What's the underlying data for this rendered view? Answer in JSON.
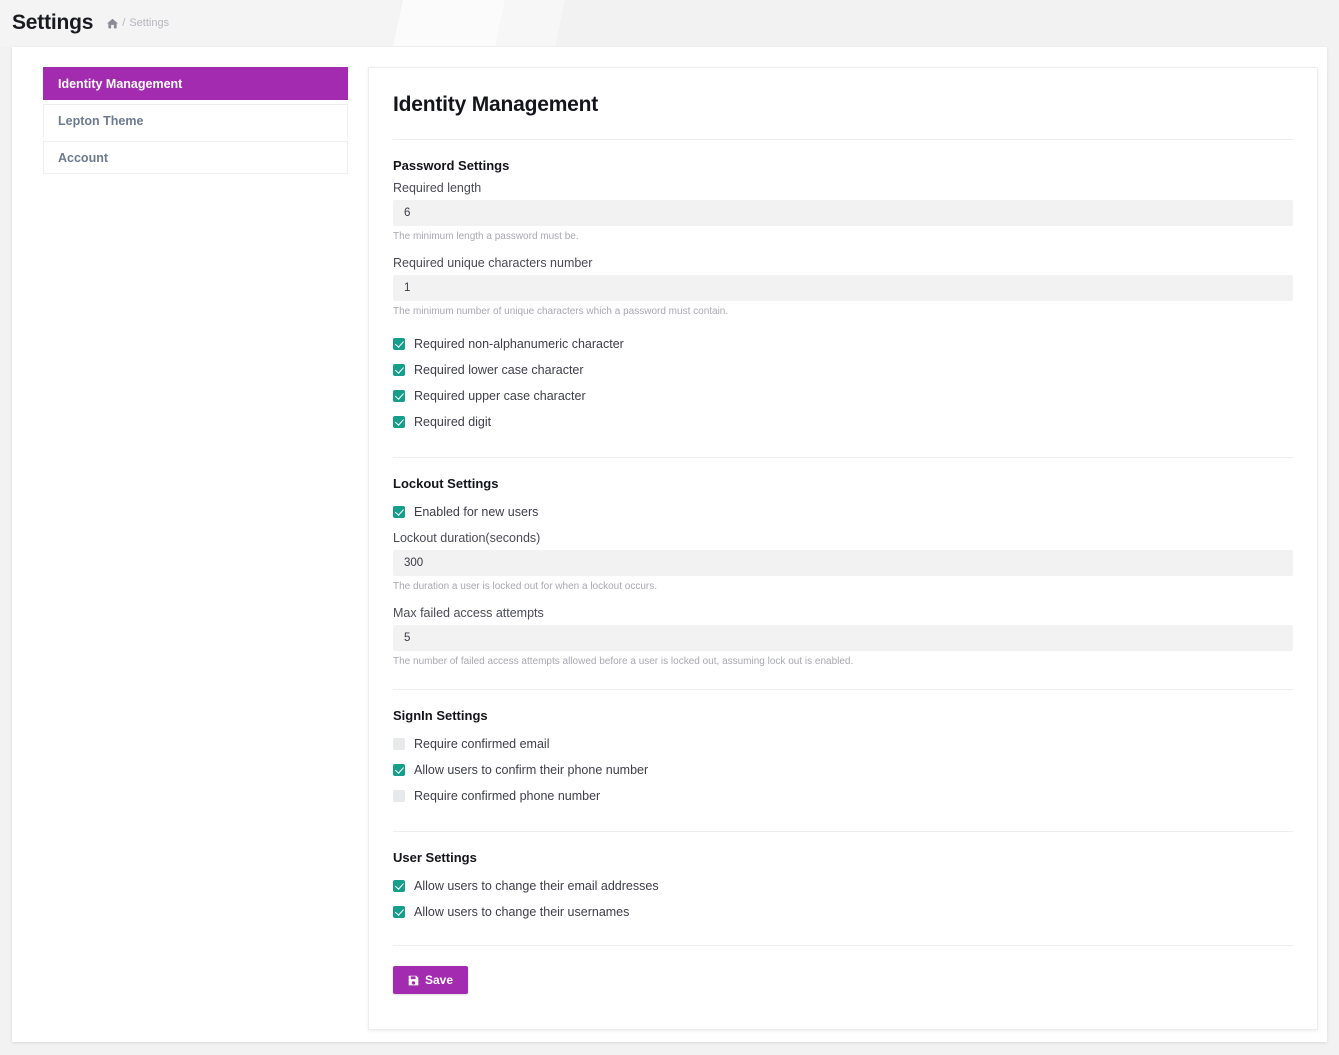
{
  "header": {
    "title": "Settings",
    "breadcrumb": {
      "home_icon": "home-icon",
      "separator": "/",
      "current": "Settings"
    }
  },
  "sidebar": {
    "items": [
      {
        "label": "Identity Management",
        "active": true
      },
      {
        "label": "Lepton Theme",
        "active": false
      },
      {
        "label": "Account",
        "active": false
      }
    ]
  },
  "main": {
    "title": "Identity Management",
    "sections": [
      {
        "id": "password-settings",
        "title": "Password Settings",
        "fields": [
          {
            "label": "Required length",
            "value": "6",
            "hint": "The minimum length a password must be."
          },
          {
            "label": "Required unique characters number",
            "value": "1",
            "hint": "The minimum number of unique characters which a password must contain."
          }
        ],
        "checkboxes": [
          {
            "label": "Required non-alphanumeric character",
            "checked": true
          },
          {
            "label": "Required lower case character",
            "checked": true
          },
          {
            "label": "Required upper case character",
            "checked": true
          },
          {
            "label": "Required digit",
            "checked": true
          }
        ]
      },
      {
        "id": "lockout-settings",
        "title": "Lockout Settings",
        "checkboxes_top": [
          {
            "label": "Enabled for new users",
            "checked": true
          }
        ],
        "fields": [
          {
            "label": "Lockout duration(seconds)",
            "value": "300",
            "hint": "The duration a user is locked out for when a lockout occurs."
          },
          {
            "label": "Max failed access attempts",
            "value": "5",
            "hint": "The number of failed access attempts allowed before a user is locked out, assuming lock out is enabled."
          }
        ]
      },
      {
        "id": "signin-settings",
        "title": "SignIn Settings",
        "checkboxes": [
          {
            "label": "Require confirmed email",
            "checked": false
          },
          {
            "label": "Allow users to confirm their phone number",
            "checked": true
          },
          {
            "label": "Require confirmed phone number",
            "checked": false
          }
        ]
      },
      {
        "id": "user-settings",
        "title": "User Settings",
        "checkboxes": [
          {
            "label": "Allow users to change their email addresses",
            "checked": true
          },
          {
            "label": "Allow users to change their usernames",
            "checked": true
          }
        ]
      }
    ],
    "save_button": {
      "label": "Save",
      "icon": "save-icon"
    }
  },
  "colors": {
    "accent_purple": "#a22bb0",
    "checkbox_teal": "#179e8a",
    "checkbox_empty": "#e7e9eb",
    "input_bg": "#f2f2f2",
    "page_bg": "#f2f2f2"
  }
}
